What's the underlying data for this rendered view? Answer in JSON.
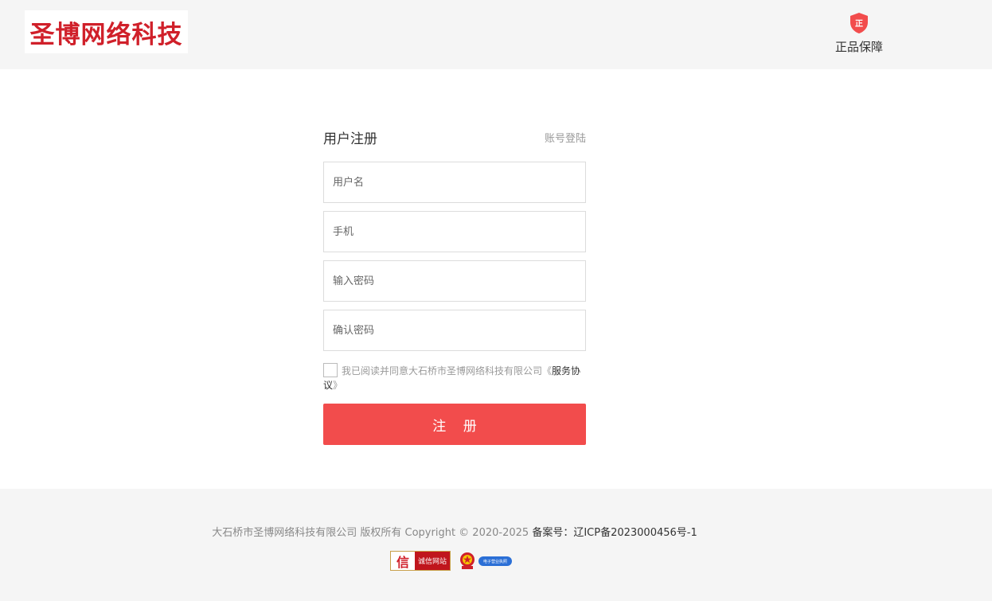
{
  "header": {
    "logo_text": "圣博网络科技",
    "guarantee_label": "正品保障",
    "guarantee_icon_text": "正"
  },
  "form": {
    "title": "用户注册",
    "login_link": "账号登陆",
    "username_placeholder": "用户名",
    "phone_placeholder": "手机",
    "password_placeholder": "输入密码",
    "confirm_placeholder": "确认密码",
    "agree_text": "我已阅读并同意大石桥市圣博网络科技有限公司《",
    "tos_text": "服务协议",
    "agree_suffix": "》",
    "submit_label": "注 册"
  },
  "footer": {
    "copyright": "大石桥市圣博网络科技有限公司 版权所有 Copyright © 2020-2025",
    "icp": "备案号：辽ICP备2023000456号-1",
    "badge_cx_char": "信",
    "badge_cx_text": "诚信网站",
    "badge_biz_text": "电子营业执照"
  },
  "colors": {
    "brand_red": "#d0202a",
    "button_red": "#f24c4c",
    "header_bg": "#f5f5f5"
  },
  "icons": {
    "guarantee": "shield-icon",
    "emblem": "national-emblem-icon"
  }
}
